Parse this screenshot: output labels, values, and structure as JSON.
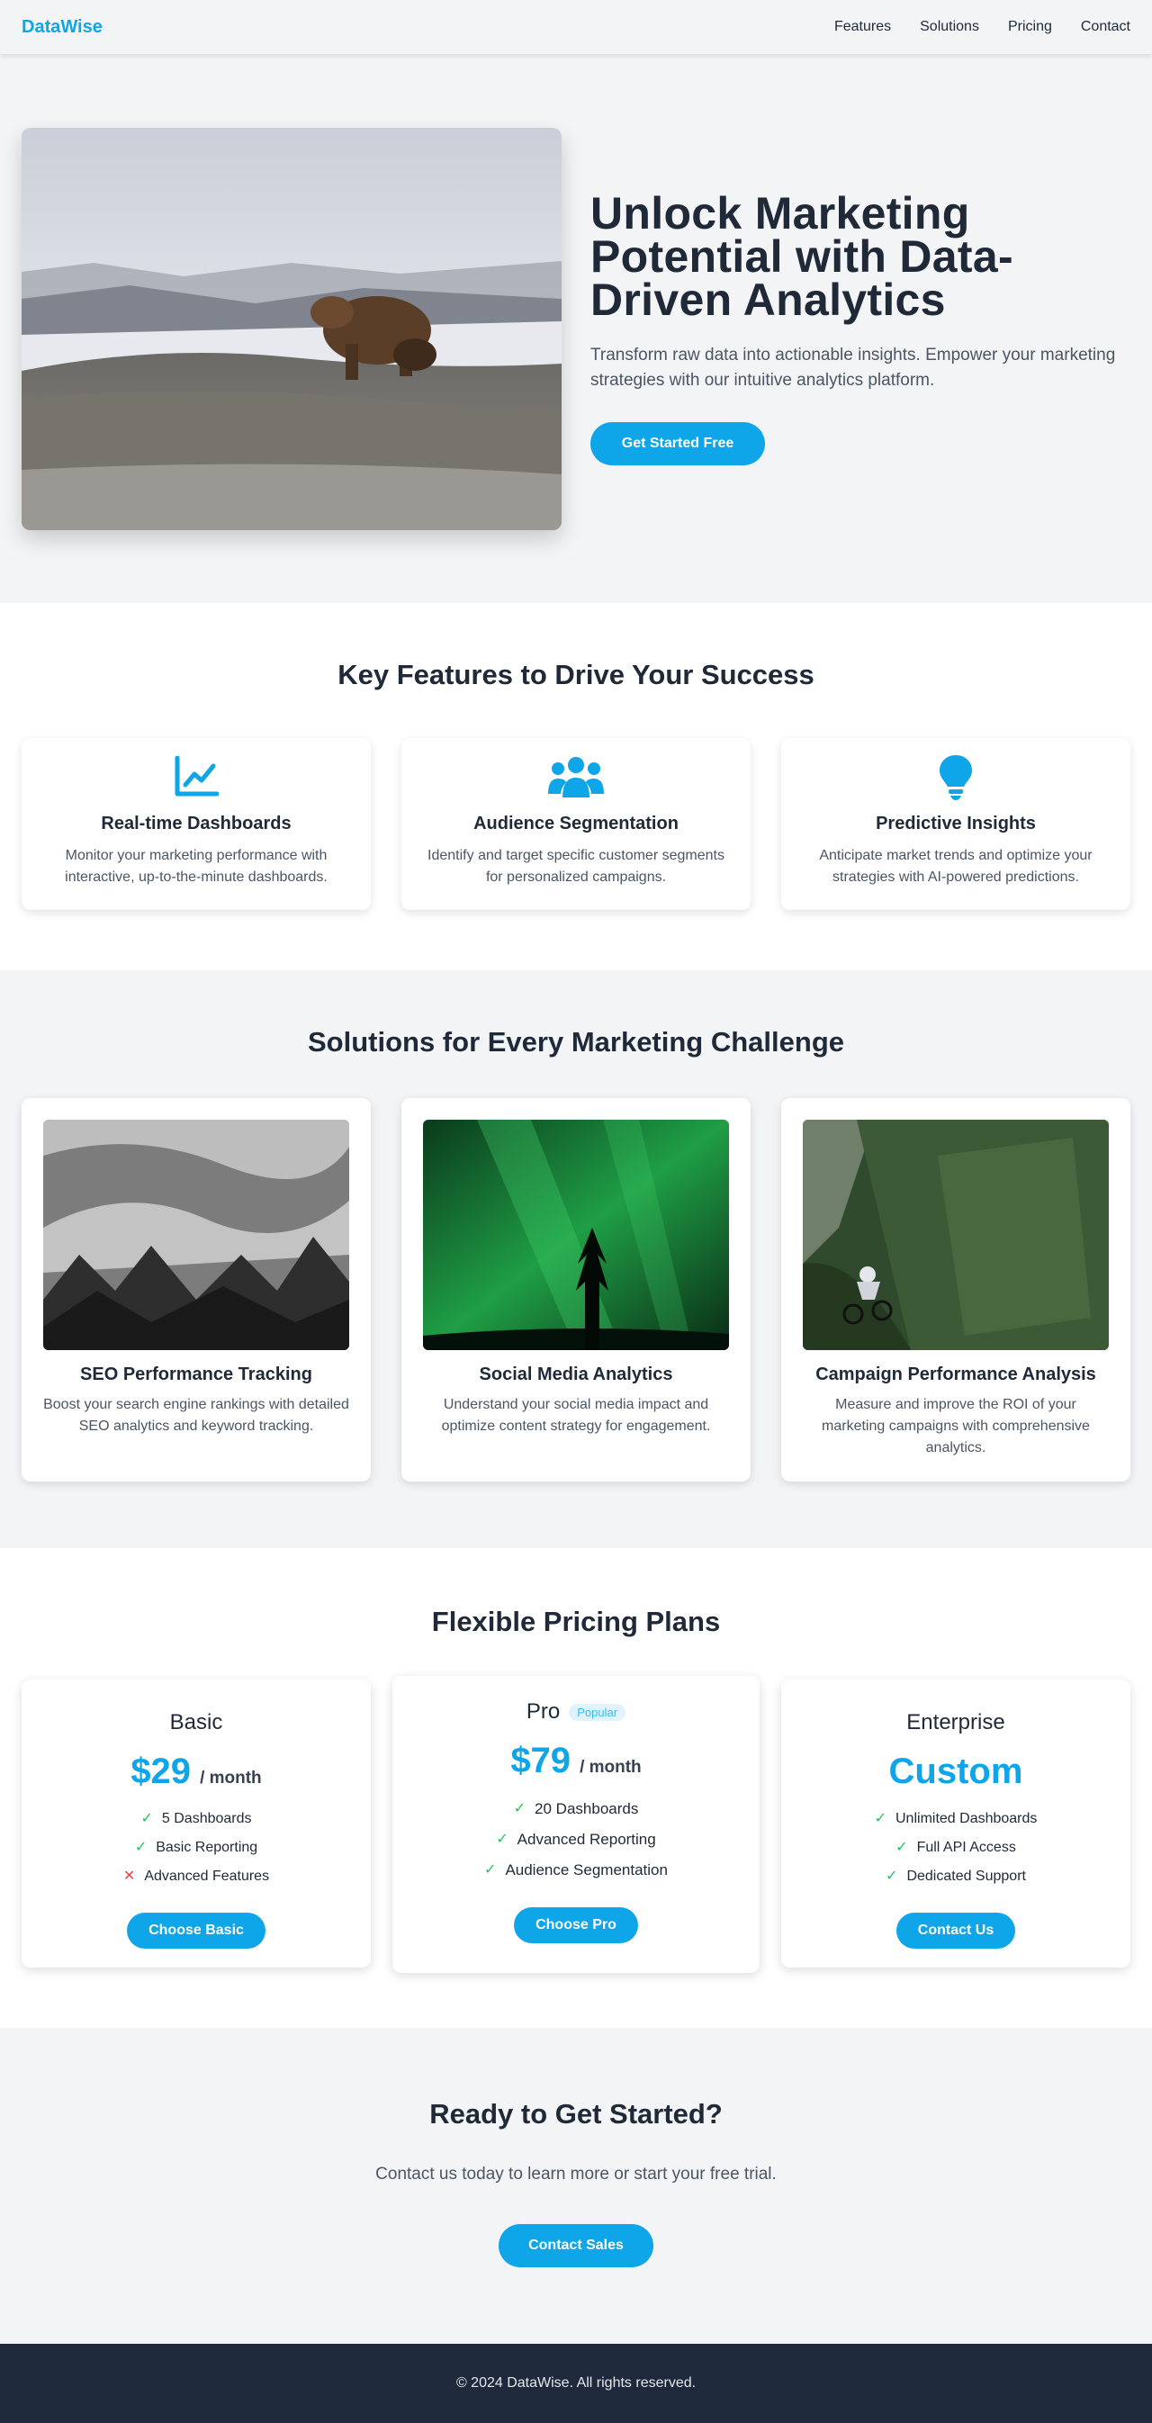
{
  "nav": {
    "logo": "DataWise",
    "links": [
      "Features",
      "Solutions",
      "Pricing",
      "Contact"
    ]
  },
  "hero": {
    "title": "Unlock Marketing Potential with Data-Driven Analytics",
    "subtitle": "Transform raw data into actionable insights. Empower your marketing strategies with our intuitive analytics platform.",
    "cta": "Get Started Free"
  },
  "features": {
    "title": "Key Features to Drive Your Success",
    "items": [
      {
        "icon": "chart-line-icon",
        "title": "Real-time Dashboards",
        "desc": "Monitor your marketing performance with interactive, up-to-the-minute dashboards."
      },
      {
        "icon": "users-icon",
        "title": "Audience Segmentation",
        "desc": "Identify and target specific customer segments for personalized campaigns."
      },
      {
        "icon": "lightbulb-icon",
        "title": "Predictive Insights",
        "desc": "Anticipate market trends and optimize your strategies with AI-powered predictions."
      }
    ]
  },
  "solutions": {
    "title": "Solutions for Every Marketing Challenge",
    "items": [
      {
        "title": "SEO Performance Tracking",
        "desc": "Boost your search engine rankings with detailed SEO analytics and keyword tracking."
      },
      {
        "title": "Social Media Analytics",
        "desc": "Understand your social media impact and optimize content strategy for engagement."
      },
      {
        "title": "Campaign Performance Analysis",
        "desc": "Measure and improve the ROI of your marketing campaigns with comprehensive analytics."
      }
    ]
  },
  "pricing": {
    "title": "Flexible Pricing Plans",
    "plans": [
      {
        "name": "Basic",
        "price": "$29",
        "period": "/ month",
        "features": [
          {
            "text": "5 Dashboards",
            "included": true
          },
          {
            "text": "Basic Reporting",
            "included": true
          },
          {
            "text": "Advanced Features",
            "included": false
          }
        ],
        "cta": "Choose Basic"
      },
      {
        "name": "Pro",
        "badge": "Popular",
        "price": "$79",
        "period": "/ month",
        "features": [
          {
            "text": "20 Dashboards",
            "included": true
          },
          {
            "text": "Advanced Reporting",
            "included": true
          },
          {
            "text": "Audience Segmentation",
            "included": true
          }
        ],
        "cta": "Choose Pro"
      },
      {
        "name": "Enterprise",
        "price": "Custom",
        "features": [
          {
            "text": "Unlimited Dashboards",
            "included": true
          },
          {
            "text": "Full API Access",
            "included": true
          },
          {
            "text": "Dedicated Support",
            "included": true
          }
        ],
        "cta": "Contact Us"
      }
    ],
    "check_glyph": "✓",
    "cross_glyph": "✕"
  },
  "cta": {
    "title": "Ready to Get Started?",
    "text": "Contact us today to learn more or start your free trial.",
    "button": "Contact Sales"
  },
  "footer": {
    "text": "© 2024 DataWise. All rights reserved."
  },
  "colors": {
    "accent": "#0ea5e9",
    "check": "#22c55e",
    "cross": "#ef4444",
    "footer_bg": "#1e293b"
  }
}
